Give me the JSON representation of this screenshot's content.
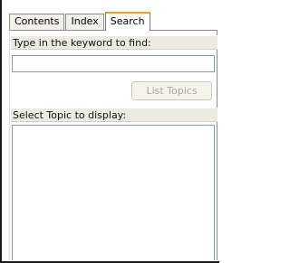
{
  "tabs": [
    {
      "label": "Contents",
      "active": false
    },
    {
      "label": "Index",
      "active": false
    },
    {
      "label": "Search",
      "active": true
    }
  ],
  "search": {
    "keyword_label": "Type in the keyword to find:",
    "keyword_value": "",
    "list_topics_label": "List Topics",
    "list_topics_enabled": false,
    "select_topic_label": "Select Topic to display:",
    "topics": []
  },
  "colors": {
    "active_tab_accent": "#e6a12e",
    "section_label_bg": "#ecebe2",
    "input_border": "#7f9db9",
    "disabled_text": "#aca899"
  }
}
